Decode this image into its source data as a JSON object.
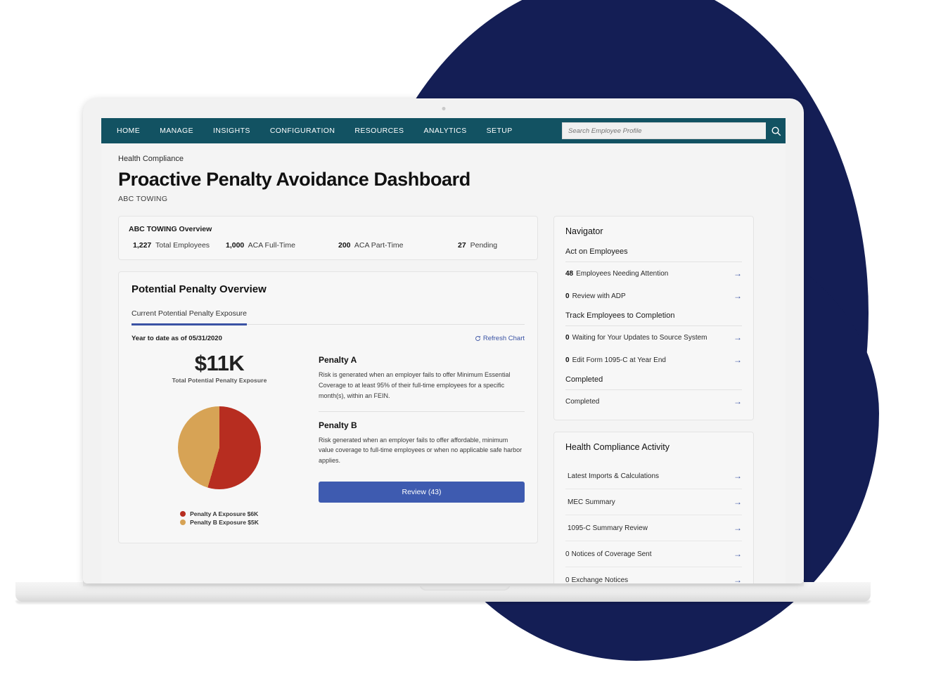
{
  "nav": {
    "items": [
      {
        "label": "HOME"
      },
      {
        "label": "MANAGE"
      },
      {
        "label": "INSIGHTS"
      },
      {
        "label": "CONFIGURATION"
      },
      {
        "label": "RESOURCES"
      },
      {
        "label": "ANALYTICS"
      },
      {
        "label": "SETUP"
      }
    ],
    "search_placeholder": "Search Employee Profile",
    "search_value": "",
    "search_icon": "search-icon",
    "bar_color": "#125262"
  },
  "header": {
    "breadcrumb": "Health Compliance",
    "title": "Proactive Penalty Avoidance Dashboard",
    "org": "ABC TOWING"
  },
  "overview": {
    "title": "ABC TOWING Overview",
    "stats": [
      {
        "value": "1,227",
        "label": "Total Employees"
      },
      {
        "value": "1,000",
        "label": "ACA Full-Time"
      },
      {
        "value": "200",
        "label": "ACA Part-Time"
      },
      {
        "value": "27",
        "label": "Pending"
      }
    ]
  },
  "penalty_card": {
    "title": "Potential Penalty Overview",
    "tabs": [
      {
        "label": "Current Potential Penalty Exposure",
        "active": true
      }
    ],
    "as_of": "Year to date as of 05/31/2020",
    "refresh_label": "Refresh Chart",
    "refresh_icon": "refresh-icon",
    "total_value": "$11K",
    "total_label": "Total Potential Penalty Exposure",
    "penalties": [
      {
        "name": "Penalty A",
        "description": "Risk is generated when an employer fails to offer Minimum Essential Coverage to at least 95% of their full-time employees for a specific month(s), within an FEIN."
      },
      {
        "name": "Penalty B",
        "description": "Risk generated when an employer fails to offer affordable, minimum value coverage to full-time employees or when no applicable safe harbor applies."
      }
    ],
    "review_button": "Review (43)",
    "accent_blue": "#3e5bb0"
  },
  "chart_data": {
    "type": "pie",
    "title": "Current Potential Penalty Exposure",
    "center_value": "$11K",
    "center_label": "Total Potential Penalty Exposure",
    "categories": [
      "Penalty A Exposure $6K",
      "Penalty B Exposure $5K"
    ],
    "values": [
      6,
      5
    ],
    "units": "thousands of USD",
    "percentages": [
      54.5,
      45.5
    ],
    "colors": [
      "#b72d20",
      "#d7a355"
    ],
    "legend": [
      {
        "label": "Penalty A Exposure $6K",
        "color": "#b72d20",
        "value": 6
      },
      {
        "label": "Penalty B Exposure $5K",
        "color": "#d7a355",
        "value": 5
      }
    ],
    "legend_position": "bottom-left",
    "grid": false
  },
  "navigator": {
    "title": "Navigator",
    "sections": [
      {
        "heading": "Act on Employees",
        "items": [
          {
            "count": "48",
            "label": "Employees Needing Attention",
            "icon": "arrow-right-icon"
          },
          {
            "count": "0",
            "label": "Review with ADP",
            "icon": "arrow-right-icon"
          }
        ]
      },
      {
        "heading": "Track Employees to Completion",
        "items": [
          {
            "count": "0",
            "label": "Waiting for Your Updates to Source System",
            "icon": "arrow-right-icon"
          },
          {
            "count": "0",
            "label": "Edit Form 1095-C at Year End",
            "icon": "arrow-right-icon"
          }
        ]
      },
      {
        "heading": "Completed",
        "items": [
          {
            "count": "",
            "label": "Completed",
            "icon": "arrow-right-icon"
          }
        ]
      }
    ]
  },
  "activity": {
    "title": "Health Compliance Activity",
    "items": [
      {
        "count": "",
        "label": "Latest Imports & Calculations",
        "icon": "arrow-right-icon"
      },
      {
        "count": "",
        "label": "MEC Summary",
        "icon": "arrow-right-icon"
      },
      {
        "count": "",
        "label": "1095-C Summary Review",
        "icon": "arrow-right-icon"
      },
      {
        "count": "0",
        "label": "Notices of Coverage Sent",
        "icon": "arrow-right-icon"
      },
      {
        "count": "0",
        "label": "Exchange Notices",
        "icon": "arrow-right-icon"
      }
    ]
  },
  "decor": {
    "blob_color": "#141e55",
    "device": "laptop"
  }
}
